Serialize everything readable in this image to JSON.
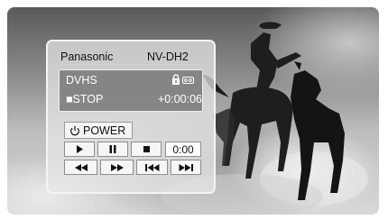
{
  "device": {
    "brand": "Panasonic",
    "model": "NV-DH2"
  },
  "display": {
    "mode": "DVHS",
    "status": "■STOP",
    "counter": "+0:00:06",
    "icons": [
      "lock-icon",
      "cassette-icon"
    ]
  },
  "controls": {
    "power_label": "POWER",
    "time_value": "0:00",
    "buttons": [
      "play",
      "pause",
      "stop",
      "rewind",
      "fast-forward",
      "skip-previous",
      "skip-next"
    ]
  },
  "colors": {
    "panel": "#e8e8e8",
    "display_bg": "#787878",
    "display_text": "#ffffff"
  }
}
